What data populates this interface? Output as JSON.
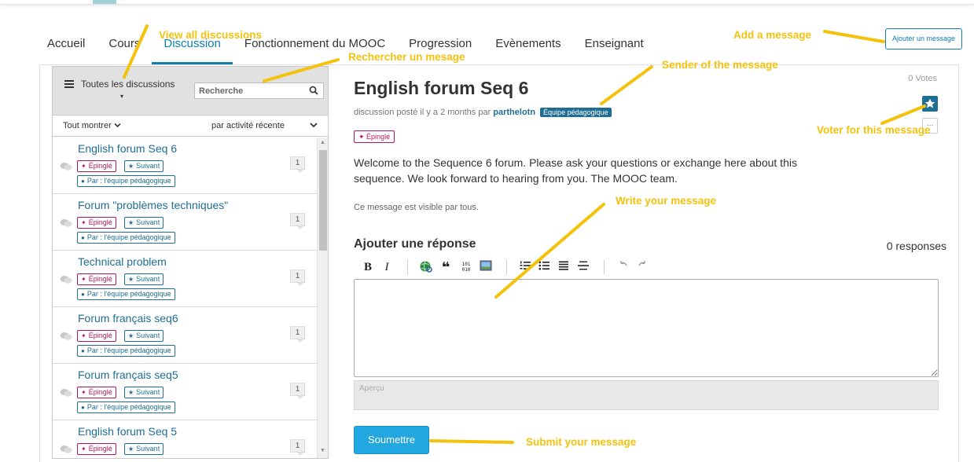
{
  "tabs": [
    {
      "label": "Accueil",
      "active": false
    },
    {
      "label": "Cours",
      "active": false
    },
    {
      "label": "Discussion",
      "active": true
    },
    {
      "label": "Fonctionnement du MOOC",
      "active": false
    },
    {
      "label": "Progression",
      "active": false
    },
    {
      "label": "Evènements",
      "active": false
    },
    {
      "label": "Enseignant",
      "active": false
    }
  ],
  "add_post_button": "Ajouter un message",
  "sidebar": {
    "all_discussions": "Toutes les discussions",
    "caret": "▾",
    "search_placeholder": "Recherche",
    "filter_show": "Tout montrer",
    "filter_sort": "par activité récente",
    "pinned_label": "Épinglé",
    "following_label": "Suivant",
    "author_label": "Par : l'équipe pédagogique",
    "threads": [
      {
        "title": "English forum Seq 6",
        "count": "1"
      },
      {
        "title": "Forum \"problèmes techniques\"",
        "count": "1"
      },
      {
        "title": "Technical problem",
        "count": "1"
      },
      {
        "title": "Forum français seq6",
        "count": "1"
      },
      {
        "title": "Forum français seq5",
        "count": "1"
      },
      {
        "title": "English forum Seq 5",
        "count": "1"
      }
    ]
  },
  "post": {
    "title": "English forum Seq 6",
    "votes": "0 Votes",
    "meta_prefix": "discussion posté il y a 2 months par",
    "author": "parthelotn",
    "staff_badge": "Équipe pédagogique",
    "pinned_label": "Épinglé",
    "body": "Welcome to the Sequence 6 forum. Please ask your questions or exchange here about this sequence. We look forward to hearing from you. The MOOC team.",
    "visibility": "Ce message est visible par tous.",
    "more": "..."
  },
  "reply": {
    "heading": "Ajouter une réponse",
    "responses": "0 responses",
    "preview_label": "Aperçu",
    "submit": "Soumettre",
    "toolbar": {
      "bold": "B",
      "italic": "I",
      "quote": "❝",
      "code": "101\n010"
    }
  },
  "annotations": {
    "view_all": "View all discussions",
    "search": "Rechercher un mesage",
    "add_message": "Add a message",
    "sender": "Sender of the message",
    "vote": "Voter for this message",
    "write": "Write your message",
    "submit": "Submit your message"
  },
  "colors": {
    "accent": "#0e7fb0",
    "link": "#1f6e95",
    "pinned": "#b2175e",
    "submit": "#22a7e0",
    "annotation": "#f4c20d"
  },
  "icons": {
    "menu": "hamburger-icon",
    "search": "search-icon",
    "vote": "star-icon",
    "pin": "pin-icon",
    "user": "user-icon",
    "comments": "comments-icon"
  }
}
